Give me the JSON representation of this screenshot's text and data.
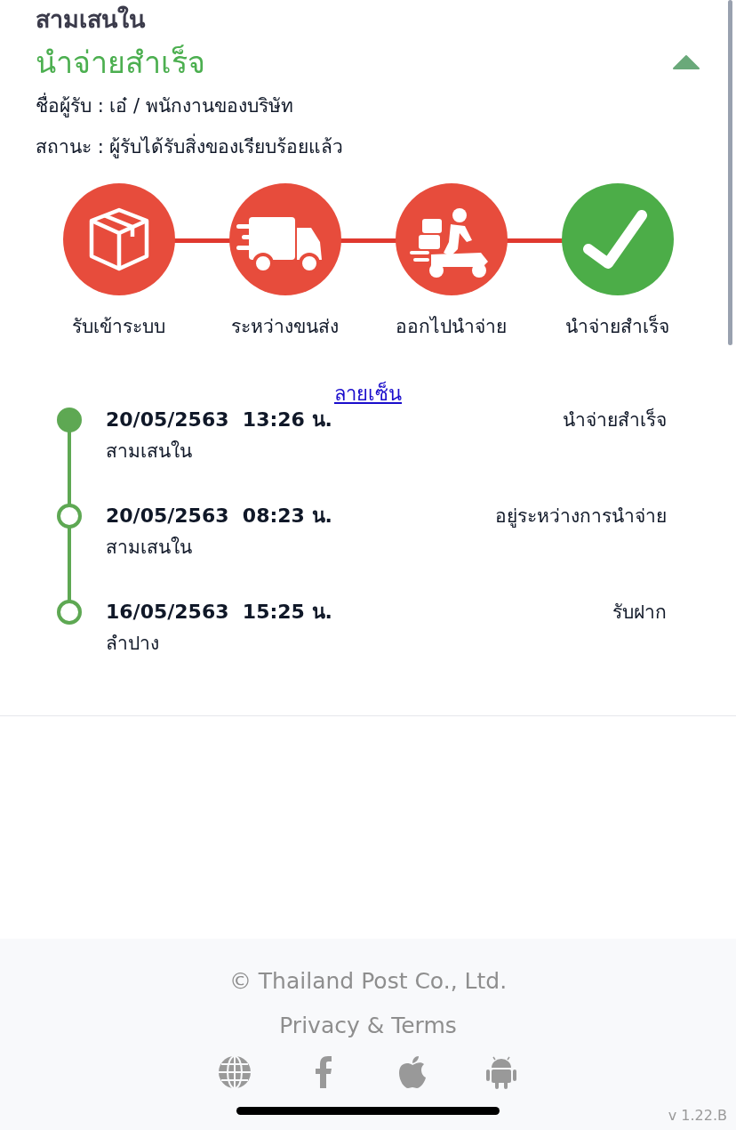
{
  "header": {
    "location": "สามเสนใน",
    "status_title": "นำจ่ายสำเร็จ",
    "expanded": true,
    "recipient": "ชื่อผู้รับ : เอ๋ / พนักงานของบริษัท",
    "status_line": "สถานะ : ผู้รับได้รับสิ่งของเรียบร้อยแล้ว"
  },
  "steps": [
    {
      "kind": "box",
      "label": "รับเข้าระบบ",
      "selected": false
    },
    {
      "kind": "truck",
      "label": "ระหว่างขนส่ง",
      "selected": false
    },
    {
      "kind": "scooter",
      "label": "ออกไปนำจ่าย",
      "selected": false
    },
    {
      "kind": "check",
      "label": "นำจ่ายสำเร็จ",
      "selected": true
    }
  ],
  "signature_link": "ลายเซ็น",
  "events": [
    {
      "datetime": "20/05/2563  13:26 น.",
      "status": "นำจ่ายสำเร็จ",
      "place": "สามเสนใน",
      "filled": true
    },
    {
      "datetime": "20/05/2563  08:23 น.",
      "status": "อยู่ระหว่างการนำจ่าย",
      "place": "สามเสนใน",
      "filled": false
    },
    {
      "datetime": "16/05/2563  15:25 น.",
      "status": "รับฝาก",
      "place": "ลำปาง",
      "filled": false
    }
  ],
  "footer": {
    "copyright": "© Thailand Post Co., Ltd.",
    "privacy_link": "Privacy & Terms",
    "links": [
      {
        "kind": "globe"
      },
      {
        "kind": "facebook"
      },
      {
        "kind": "apple"
      },
      {
        "kind": "android"
      }
    ],
    "version": "v 1.22.B"
  }
}
